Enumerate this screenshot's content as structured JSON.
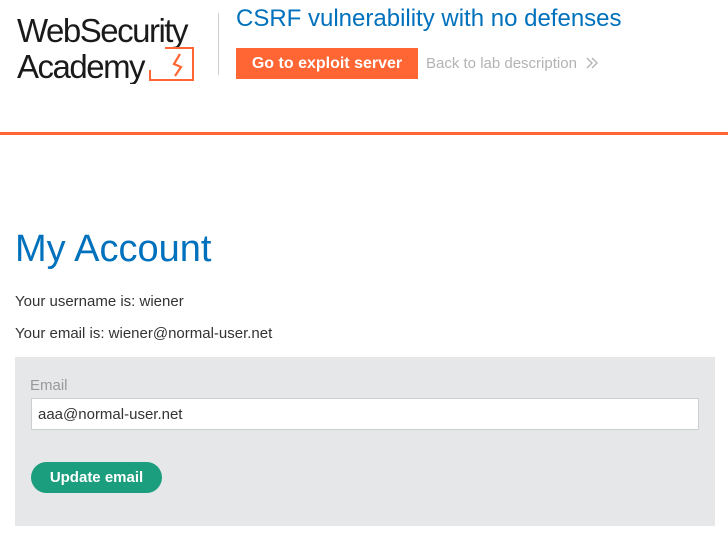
{
  "header": {
    "logo": {
      "line1": "WebSecurity",
      "line2": "Academy"
    },
    "lab_title": "CSRF vulnerability with no defenses",
    "exploit_button_label": "Go to exploit server",
    "back_link_label": "Back to lab description",
    "accent_color": "#ff6633"
  },
  "main": {
    "heading": "My Account",
    "username_line": "Your username is: wiener",
    "email_line": "Your email is: wiener@normal-user.net",
    "form": {
      "email_label": "Email",
      "email_value": "aaa@normal-user.net",
      "submit_label": "Update email",
      "submit_color": "#1b9e7e"
    }
  },
  "icons": {
    "logo_mark": "lightning-bolt-icon",
    "back_link_chevron": "double-chevron-right-icon"
  }
}
